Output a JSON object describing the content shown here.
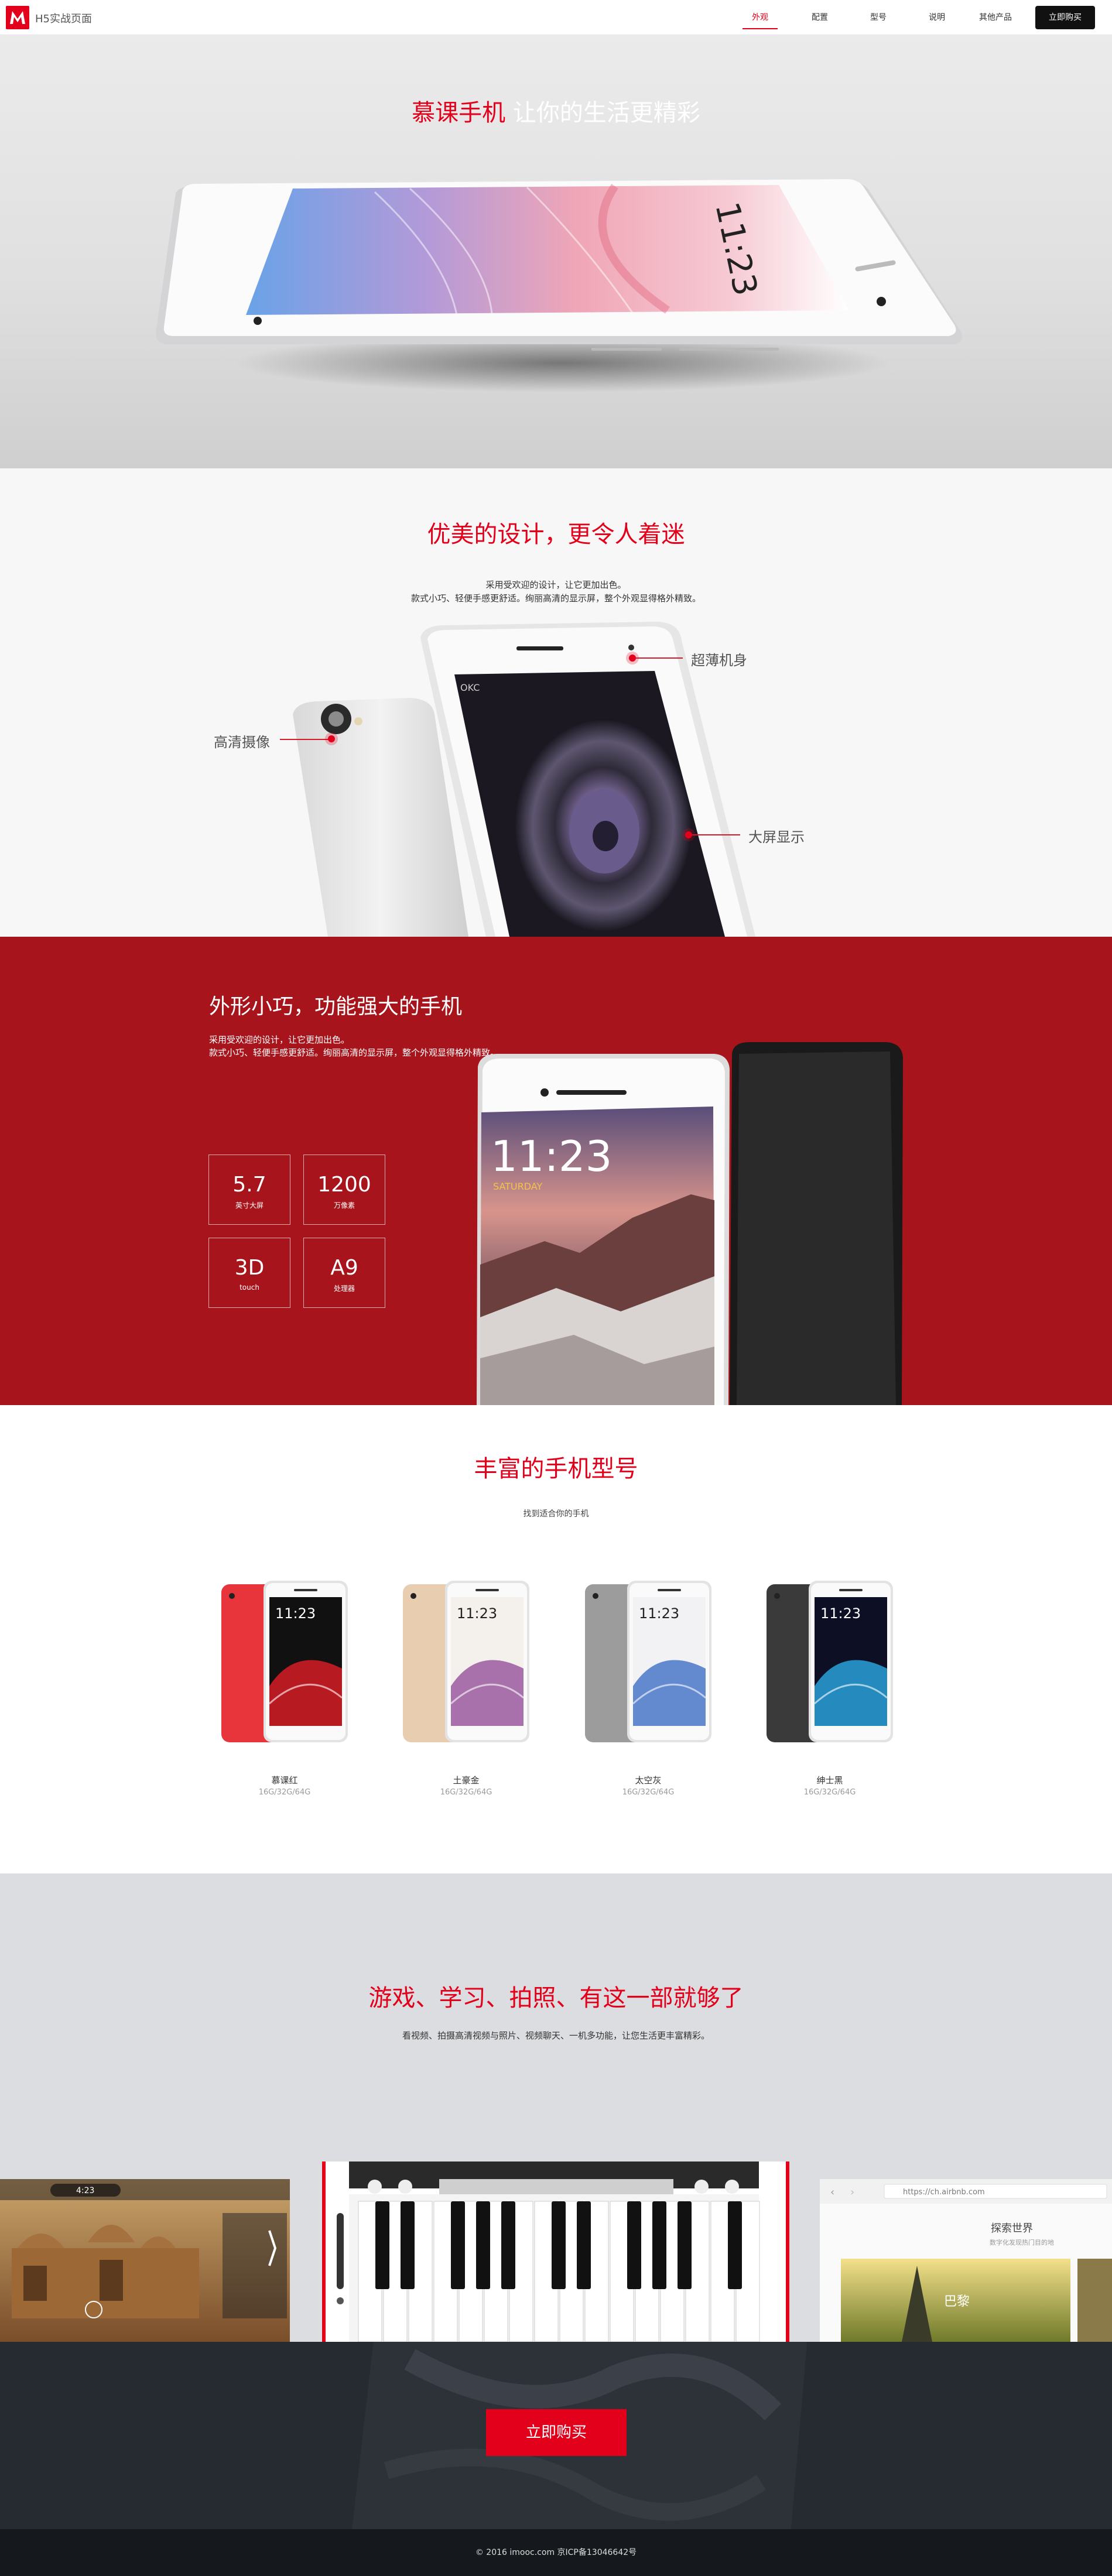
{
  "header": {
    "brand": "H5实战页面",
    "nav": [
      {
        "label": "外观"
      },
      {
        "label": "配置"
      },
      {
        "label": "型号"
      },
      {
        "label": "说明"
      },
      {
        "label": "其他产品"
      }
    ],
    "buy_label": "立即购买",
    "active_nav": "外观"
  },
  "hero": {
    "title_red": "慕课手机",
    "title_white": " 让你的生活更精彩",
    "phone_time": "11:23"
  },
  "design": {
    "title": "优美的设计，更令人着迷",
    "desc_line1": "采用受欢迎的设计，让它更加出色。",
    "desc_line2": "款式小巧、轻便手感更舒适。绚丽高清的显示屏，整个外观显得格外精致。",
    "callout_body": "超薄机身",
    "callout_camera": "高清摄像",
    "callout_screen": "大屏显示",
    "phone_brand": "OKC"
  },
  "features": {
    "title": "外形小巧，功能强大的手机",
    "desc_line1": "采用受欢迎的设计，让它更加出色。",
    "desc_line2": "款式小巧、轻便手感更舒适。绚丽高清的显示屏，整个外观显得格外精致。",
    "specs": [
      {
        "value": "5.7",
        "unit": "英寸大屏"
      },
      {
        "value": "1200",
        "unit": "万像素"
      },
      {
        "value": "3D",
        "unit": "touch"
      },
      {
        "value": "A9",
        "unit": "处理器"
      }
    ],
    "phone_time": "11:23",
    "phone_day": "SATURDAY"
  },
  "models": {
    "title": "丰富的手机型号",
    "subtitle": "找到适合你的手机",
    "items": [
      {
        "name": "慕课红",
        "spec": "16G/32G/64G",
        "color": "#e8353c",
        "wave": "#d61c24",
        "bg": "#111111"
      },
      {
        "name": "土豪金",
        "spec": "16G/32G/64G",
        "color": "#e9cdb0",
        "wave": "#9b5aa0",
        "bg": "#f4f0ec"
      },
      {
        "name": "太空灰",
        "spec": "16G/32G/64G",
        "color": "#9c9c9c",
        "wave": "#4a78c8",
        "bg": "#f2f2f4"
      },
      {
        "name": "绅士黑",
        "spec": "16G/32G/64G",
        "color": "#3a3a3a",
        "wave": "#2aa0d8",
        "bg": "#0d1024"
      }
    ],
    "phone_time": "11:23"
  },
  "apps": {
    "title": "游戏、学习、拍照、有这一部就够了",
    "desc": "看视频、拍摄高清视频与照片、视频聊天、一机多功能，让您生活更丰富精彩。",
    "game_timer": "4:23",
    "browser_url": "https://ch.airbnb.com",
    "browser_heading": "探索世界",
    "browser_sub": "数字化发现热门目的地",
    "browser_city": "巴黎"
  },
  "buy": {
    "button": "立即购买"
  },
  "footer": {
    "text": "© 2016 imooc.com 京ICP备13046642号"
  }
}
